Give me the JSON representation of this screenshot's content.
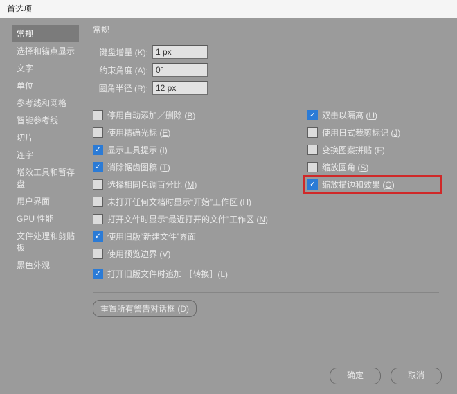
{
  "window": {
    "title": "首选项"
  },
  "sidebar": {
    "items": [
      "常规",
      "选择和锚点显示",
      "文字",
      "单位",
      "参考线和网格",
      "智能参考线",
      "切片",
      "连字",
      "增效工具和暂存盘",
      "用户界面",
      "GPU 性能",
      "文件处理和剪贴板",
      "黑色外观"
    ],
    "selected_index": 0
  },
  "panel": {
    "title": "常规",
    "fields": {
      "key_increment": {
        "label": "键盘增量 (K):",
        "value": "1 px"
      },
      "constrain_angle": {
        "label": "约束角度 (A):",
        "value": "0°"
      },
      "corner_radius": {
        "label": "圆角半径 (R):",
        "value": "12 px"
      }
    },
    "left_checks": [
      {
        "checked": false,
        "text": "停用自动添加／删除 (",
        "hot": "B",
        "tail": ")"
      },
      {
        "checked": false,
        "text": "使用精确光标 (",
        "hot": "E",
        "tail": ")"
      },
      {
        "checked": true,
        "text": "显示工具提示 (",
        "hot": "I",
        "tail": ")"
      },
      {
        "checked": true,
        "text": "消除锯齿图稿 (",
        "hot": "T",
        "tail": ")"
      },
      {
        "checked": false,
        "text": "选择相同色调百分比 (",
        "hot": "M",
        "tail": ")"
      },
      {
        "checked": false,
        "text": "未打开任何文档时显示“开始”工作区 (",
        "hot": "H",
        "tail": ")"
      },
      {
        "checked": false,
        "text": "打开文件时显示“最近打开的文件”工作区 (",
        "hot": "N",
        "tail": ")"
      },
      {
        "checked": true,
        "text": "使用旧版“新建文件”界面",
        "hot": "",
        "tail": ""
      },
      {
        "checked": false,
        "text": "使用预览边界 (",
        "hot": "V",
        "tail": ")"
      },
      {
        "checked": true,
        "text": "打开旧版文件时追加 ［转换］(",
        "hot": "L",
        "tail": ")",
        "gap": true
      }
    ],
    "right_checks": [
      {
        "checked": true,
        "text": "双击以隔离 (",
        "hot": "U",
        "tail": ")"
      },
      {
        "checked": false,
        "text": "使用日式裁剪标记 (",
        "hot": "J",
        "tail": ")"
      },
      {
        "checked": false,
        "text": "变换图案拼贴 (",
        "hot": "F",
        "tail": ")"
      },
      {
        "checked": false,
        "text": "缩放圆角 (",
        "hot": "S",
        "tail": ")"
      },
      {
        "checked": true,
        "text": "缩放描边和效果 (",
        "hot": "O",
        "tail": ")",
        "highlighted": true
      }
    ],
    "reset_button": "重置所有警告对话框 (D)"
  },
  "footer": {
    "ok": "确定",
    "cancel": "取消"
  }
}
